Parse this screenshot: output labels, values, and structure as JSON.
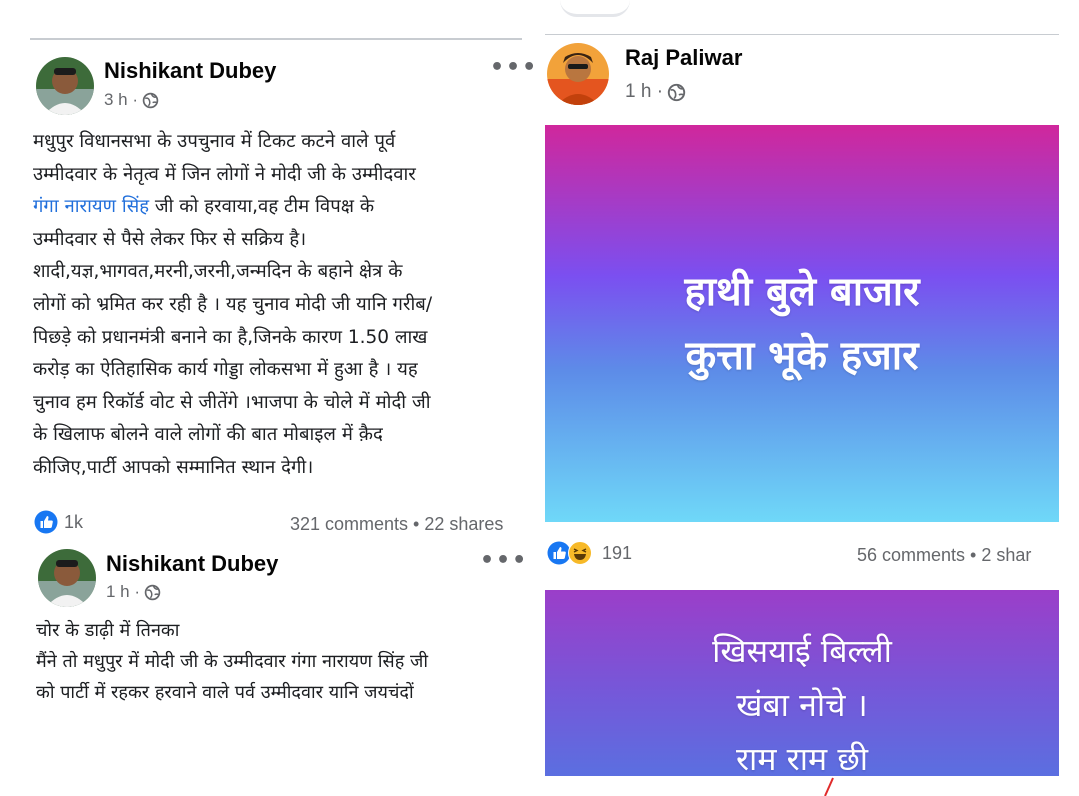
{
  "left_panel": {
    "post1": {
      "author": "Nishikant Dubey",
      "time": "3 h ·",
      "text_line1": "मधुपुर विधानसभा के उपचुनाव में टिकट कटने वाले पूर्व",
      "text_line2": "उम्मीदवार के नेतृत्व में जिन लोगों ने मोदी जी के उम्मीदवार",
      "text_line3_link": "गंगा नारायण सिंह",
      "text_line3_rest": " जी को हरवाया,वह टीम विपक्ष के",
      "text_line4": "उम्मीदवार से पैसे लेकर फिर से सक्रिय है।",
      "text_line5": "शादी,यज्ञ,भागवत,मरनी,जरनी,जन्मदिन के बहाने क्षेत्र के",
      "text_line6": "लोगों को भ्रमित कर रही है । यह चुनाव मोदी जी यानि गरीब/",
      "text_line7": "पिछड़े को प्रधानमंत्री बनाने का है,जिनके कारण 1.50 लाख",
      "text_line8": "करोड़ का ऐतिहासिक कार्य गोड्डा लोकसभा में हुआ है । यह",
      "text_line9": "चुनाव हम रिकॉर्ड वोट से जीतेंगे ।भाजपा के चोले में मोदी जी",
      "text_line10": "के खिलाफ बोलने वाले लोगों की बात मोबाइल में क़ैद",
      "text_line11": "कीजिए,पार्टी आपको सम्मानित स्थान देगी।",
      "reaction_count": "1k",
      "stats": "321 comments • 22 shares",
      "more_label": "•••"
    },
    "post2": {
      "author": "Nishikant Dubey",
      "time": "1 h ·",
      "text_line1": "चोर के डाढ़ी में तिनका",
      "text_line2": "मैंने तो मधुपुर में मोदी जी के उम्मीदवार गंगा नारायण सिंह जी",
      "text_line3": "को पार्टी में रहकर हरवाने वाले पर्व उम्मीदवार यानि जयचंदों",
      "more_label": "•••"
    }
  },
  "right_panel": {
    "post1": {
      "author": "Raj Paliwar",
      "time": "1 h ·",
      "banner_line1": "हाथी बुले बाजार",
      "banner_line2": "कुत्ता भूके हजार",
      "reaction_count": "191",
      "stats": "56 comments • 2 shar"
    },
    "post2": {
      "banner_line1": "खिसयाई बिल्ली",
      "banner_line2": "खंबा नोचे ।",
      "banner_line3": "राम राम छी"
    }
  },
  "colors": {
    "link": "#216fdb",
    "meta_gray": "#65676b",
    "like_blue": "#1877f2",
    "haha_yellow": "#f7b928"
  },
  "icons": [
    "globe-icon",
    "more-icon",
    "like-icon",
    "haha-icon"
  ]
}
